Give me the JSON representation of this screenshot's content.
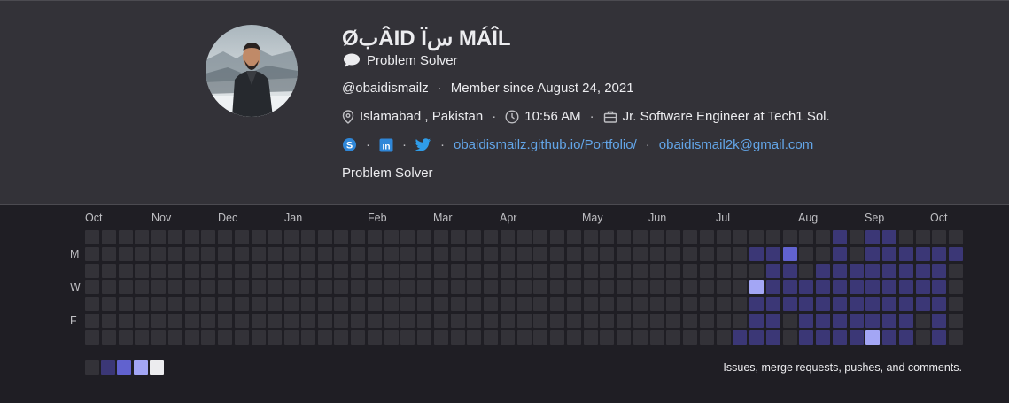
{
  "profile": {
    "name": "ØبÂID Ïس MÁÎL",
    "status": "Problem Solver",
    "username": "@obaidismailz",
    "member_since": "Member since August 24, 2021",
    "location": "Islamabad , Pakistan",
    "local_time": "10:56 AM",
    "job": "Jr. Software Engineer at Tech1 Sol.",
    "website": "obaidismailz.github.io/Portfolio/",
    "email": "obaidismail2k@gmail.com",
    "bio": "Problem Solver",
    "social_icons": [
      "skype-icon",
      "linkedin-icon",
      "twitter-icon"
    ]
  },
  "calendar": {
    "months": [
      "Oct",
      "Nov",
      "Dec",
      "Jan",
      "Feb",
      "Mar",
      "Apr",
      "May",
      "Jun",
      "Jul",
      "Aug",
      "Sep",
      "Oct"
    ],
    "day_labels": [
      "M",
      "W",
      "F"
    ],
    "legend_text": "Issues, merge requests, pushes, and comments.",
    "level_colors": [
      "#333238",
      "#3b3776",
      "#6162cf",
      "#a3a6f5",
      "#ececef"
    ],
    "weeks": 53,
    "activity_levels": [
      [
        0,
        0,
        0,
        0,
        0,
        0,
        0,
        0,
        0,
        0,
        0,
        0,
        0,
        0,
        0,
        0,
        0,
        0,
        0,
        0,
        0,
        0,
        0,
        0,
        0,
        0,
        0,
        0,
        0,
        0,
        0,
        0,
        0,
        0,
        0,
        0,
        0,
        0,
        0,
        0,
        0,
        0,
        0,
        0,
        0,
        1,
        0,
        1,
        1,
        0,
        0,
        0,
        0
      ],
      [
        0,
        0,
        0,
        0,
        0,
        0,
        0,
        0,
        0,
        0,
        0,
        0,
        0,
        0,
        0,
        0,
        0,
        0,
        0,
        0,
        0,
        0,
        0,
        0,
        0,
        0,
        0,
        0,
        0,
        0,
        0,
        0,
        0,
        0,
        0,
        0,
        0,
        0,
        0,
        0,
        1,
        1,
        2,
        0,
        0,
        1,
        0,
        1,
        1,
        1,
        1,
        1,
        1
      ],
      [
        0,
        0,
        0,
        0,
        0,
        0,
        0,
        0,
        0,
        0,
        0,
        0,
        0,
        0,
        0,
        0,
        0,
        0,
        0,
        0,
        0,
        0,
        0,
        0,
        0,
        0,
        0,
        0,
        0,
        0,
        0,
        0,
        0,
        0,
        0,
        0,
        0,
        0,
        0,
        0,
        0,
        1,
        1,
        0,
        1,
        1,
        1,
        1,
        1,
        1,
        1,
        1,
        0
      ],
      [
        0,
        0,
        0,
        0,
        0,
        0,
        0,
        0,
        0,
        0,
        0,
        0,
        0,
        0,
        0,
        0,
        0,
        0,
        0,
        0,
        0,
        0,
        0,
        0,
        0,
        0,
        0,
        0,
        0,
        0,
        0,
        0,
        0,
        0,
        0,
        0,
        0,
        0,
        0,
        0,
        3,
        1,
        1,
        1,
        1,
        1,
        1,
        1,
        1,
        1,
        1,
        1,
        0
      ],
      [
        0,
        0,
        0,
        0,
        0,
        0,
        0,
        0,
        0,
        0,
        0,
        0,
        0,
        0,
        0,
        0,
        0,
        0,
        0,
        0,
        0,
        0,
        0,
        0,
        0,
        0,
        0,
        0,
        0,
        0,
        0,
        0,
        0,
        0,
        0,
        0,
        0,
        0,
        0,
        0,
        1,
        1,
        1,
        1,
        1,
        1,
        1,
        1,
        1,
        1,
        1,
        1,
        0
      ],
      [
        0,
        0,
        0,
        0,
        0,
        0,
        0,
        0,
        0,
        0,
        0,
        0,
        0,
        0,
        0,
        0,
        0,
        0,
        0,
        0,
        0,
        0,
        0,
        0,
        0,
        0,
        0,
        0,
        0,
        0,
        0,
        0,
        0,
        0,
        0,
        0,
        0,
        0,
        0,
        0,
        1,
        1,
        0,
        1,
        1,
        1,
        1,
        1,
        1,
        1,
        0,
        1,
        0
      ],
      [
        0,
        0,
        0,
        0,
        0,
        0,
        0,
        0,
        0,
        0,
        0,
        0,
        0,
        0,
        0,
        0,
        0,
        0,
        0,
        0,
        0,
        0,
        0,
        0,
        0,
        0,
        0,
        0,
        0,
        0,
        0,
        0,
        0,
        0,
        0,
        0,
        0,
        0,
        0,
        1,
        1,
        1,
        0,
        1,
        1,
        1,
        1,
        3,
        1,
        1,
        0,
        1,
        0
      ]
    ]
  }
}
